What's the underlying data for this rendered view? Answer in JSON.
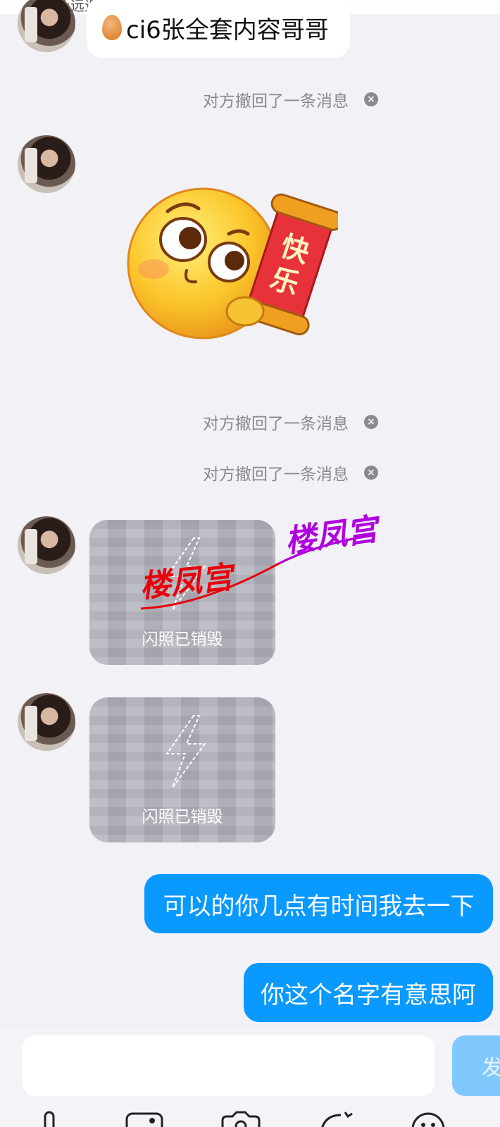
{
  "top_strip": {
    "text": "永远追随 >"
  },
  "messages": {
    "m1_text": "ci6张全套内容哥哥",
    "recall_text": "对方撤回了一条消息",
    "flash_label": "闪照已销毁",
    "sticker_text": "快乐",
    "watermark": "楼凤宫",
    "out1": "可以的你几点有时间我去一下",
    "out2": "你这个名字有意思阿"
  },
  "input": {
    "placeholder": "",
    "send_label": "发"
  },
  "toolbar": {
    "icons": [
      "microphone-icon",
      "image-icon",
      "camera-icon",
      "red-packet-icon",
      "emoji-icon"
    ]
  },
  "colors": {
    "background": "#f1f1f6",
    "outgoing_bubble": "#0a99ff",
    "send_button": "#7fc9ff",
    "watermark_red": "#e8000b",
    "watermark_purple": "#b000e0"
  }
}
